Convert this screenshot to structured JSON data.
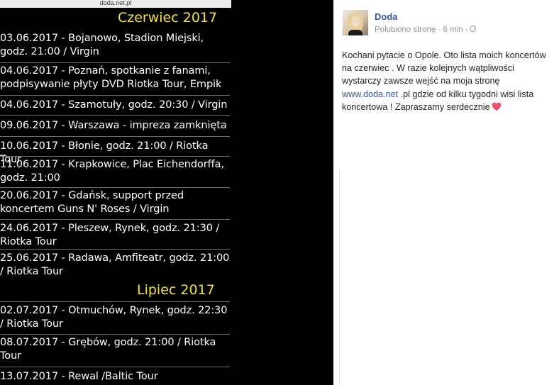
{
  "image": {
    "site_url": "doda.net.pl",
    "sections": [
      {
        "header": "Czerwiec 2017",
        "entries": [
          "03.06.2017 - Bojanowo, Stadion Miejski,\ngodz. 21:00 / Virgin",
          "04.06.2017 - Poznań, spotkanie z fanami,\npodpisywanie płyty DVD Riotka Tour, Empik",
          "04.06.2017 - Szamotuły, godz. 20:30 / Virgin",
          "09.06.2017 - Warszawa - impreza zamknięta",
          "10.06.2017 - Błonie, godz. 21:00 / Riotka Tour",
          "11.06.2017 - Krapkowice, Plac Eichendorffa,\ngodz. 21:00",
          "20.06.2017 - Gdańsk, support przed\nkoncertem Guns N' Roses / Virgin",
          "24.06.2017 - Pleszew, Rynek, godz. 21:30 /\nRiotka Tour",
          "25.06.2017 - Radawa, Amfiteatr, godz. 21:00\n/ Riotka Tour"
        ]
      },
      {
        "header": "Lipiec 2017",
        "entries": [
          "02.07.2017 - Otmuchów, Rynek, godz. 22:30\n/ Riotka Tour",
          "08.07.2017 - Grębów, godz. 21:00 / Riotka\nTour",
          "13.07.2017 - Rewal /Baltic Tour"
        ]
      }
    ]
  },
  "post": {
    "author": "Doda",
    "meta": "Polubiono stronę · 6 min ·",
    "text_before_link": "Kochani pytacie o Opole. Oto lista moich koncertów na czerwiec . W razie kolejnych wątpliwości wystarczy zawsze wejść na moja stronę ",
    "link": "www.doda.net",
    "text_after_link": " .pl gdzie od kilku tygodni wisi lista koncertowa ! Zapraszamy serdecznie",
    "accent_color": "#365899",
    "heart_color": "#f25268",
    "icons": [
      "globe-icon",
      "heart-icon"
    ]
  }
}
